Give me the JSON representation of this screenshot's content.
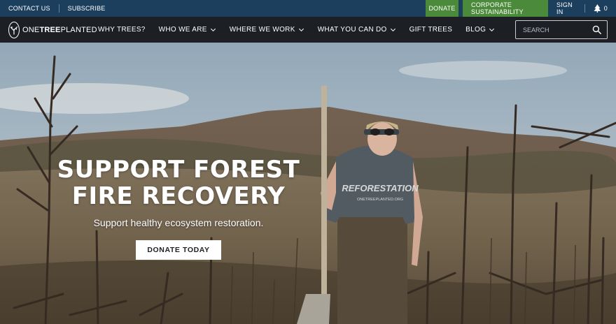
{
  "topbar": {
    "contact_label": "CONTACT US",
    "subscribe_label": "SUBSCRIBE",
    "donate_label": "DONATE",
    "corporate_label": "CORPORATE SUSTAINABILITY",
    "signin_label": "SIGN IN",
    "cart_count": "0",
    "bg_color": "#1d3f5e",
    "accent_color": "#4c8a3b"
  },
  "nav": {
    "logo_prefix": "ONE",
    "logo_bold": "TREE",
    "logo_suffix": "PLANTED",
    "items": [
      {
        "label": "WHY TREES?",
        "has_dropdown": false
      },
      {
        "label": "WHO WE ARE",
        "has_dropdown": true
      },
      {
        "label": "WHERE WE WORK",
        "has_dropdown": true
      },
      {
        "label": "WHAT YOU CAN DO",
        "has_dropdown": true
      },
      {
        "label": "GIFT TREES",
        "has_dropdown": false
      },
      {
        "label": "BLOG",
        "has_dropdown": true
      }
    ],
    "search": {
      "placeholder": "SEARCH",
      "value": ""
    }
  },
  "hero": {
    "title_line1": "SUPPORT FOREST",
    "title_line2": "FIRE RECOVERY",
    "subtitle": "Support healthy ecosystem restoration.",
    "cta_label": "DONATE TODAY",
    "shirt_text": "REFORESTATION",
    "shirt_subtext": "ONETREEPLANTED.ORG"
  }
}
